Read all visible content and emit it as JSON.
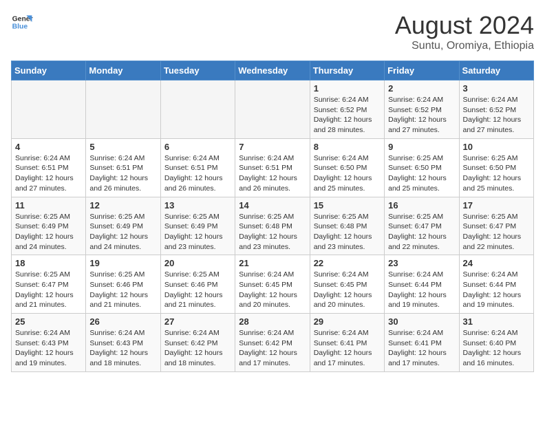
{
  "header": {
    "logo_line1": "General",
    "logo_line2": "Blue",
    "month_title": "August 2024",
    "location": "Suntu, Oromiya, Ethiopia"
  },
  "days_of_week": [
    "Sunday",
    "Monday",
    "Tuesday",
    "Wednesday",
    "Thursday",
    "Friday",
    "Saturday"
  ],
  "weeks": [
    [
      {
        "day": "",
        "info": ""
      },
      {
        "day": "",
        "info": ""
      },
      {
        "day": "",
        "info": ""
      },
      {
        "day": "",
        "info": ""
      },
      {
        "day": "1",
        "info": "Sunrise: 6:24 AM\nSunset: 6:52 PM\nDaylight: 12 hours\nand 28 minutes."
      },
      {
        "day": "2",
        "info": "Sunrise: 6:24 AM\nSunset: 6:52 PM\nDaylight: 12 hours\nand 27 minutes."
      },
      {
        "day": "3",
        "info": "Sunrise: 6:24 AM\nSunset: 6:52 PM\nDaylight: 12 hours\nand 27 minutes."
      }
    ],
    [
      {
        "day": "4",
        "info": "Sunrise: 6:24 AM\nSunset: 6:51 PM\nDaylight: 12 hours\nand 27 minutes."
      },
      {
        "day": "5",
        "info": "Sunrise: 6:24 AM\nSunset: 6:51 PM\nDaylight: 12 hours\nand 26 minutes."
      },
      {
        "day": "6",
        "info": "Sunrise: 6:24 AM\nSunset: 6:51 PM\nDaylight: 12 hours\nand 26 minutes."
      },
      {
        "day": "7",
        "info": "Sunrise: 6:24 AM\nSunset: 6:51 PM\nDaylight: 12 hours\nand 26 minutes."
      },
      {
        "day": "8",
        "info": "Sunrise: 6:24 AM\nSunset: 6:50 PM\nDaylight: 12 hours\nand 25 minutes."
      },
      {
        "day": "9",
        "info": "Sunrise: 6:25 AM\nSunset: 6:50 PM\nDaylight: 12 hours\nand 25 minutes."
      },
      {
        "day": "10",
        "info": "Sunrise: 6:25 AM\nSunset: 6:50 PM\nDaylight: 12 hours\nand 25 minutes."
      }
    ],
    [
      {
        "day": "11",
        "info": "Sunrise: 6:25 AM\nSunset: 6:49 PM\nDaylight: 12 hours\nand 24 minutes."
      },
      {
        "day": "12",
        "info": "Sunrise: 6:25 AM\nSunset: 6:49 PM\nDaylight: 12 hours\nand 24 minutes."
      },
      {
        "day": "13",
        "info": "Sunrise: 6:25 AM\nSunset: 6:49 PM\nDaylight: 12 hours\nand 23 minutes."
      },
      {
        "day": "14",
        "info": "Sunrise: 6:25 AM\nSunset: 6:48 PM\nDaylight: 12 hours\nand 23 minutes."
      },
      {
        "day": "15",
        "info": "Sunrise: 6:25 AM\nSunset: 6:48 PM\nDaylight: 12 hours\nand 23 minutes."
      },
      {
        "day": "16",
        "info": "Sunrise: 6:25 AM\nSunset: 6:47 PM\nDaylight: 12 hours\nand 22 minutes."
      },
      {
        "day": "17",
        "info": "Sunrise: 6:25 AM\nSunset: 6:47 PM\nDaylight: 12 hours\nand 22 minutes."
      }
    ],
    [
      {
        "day": "18",
        "info": "Sunrise: 6:25 AM\nSunset: 6:47 PM\nDaylight: 12 hours\nand 21 minutes."
      },
      {
        "day": "19",
        "info": "Sunrise: 6:25 AM\nSunset: 6:46 PM\nDaylight: 12 hours\nand 21 minutes."
      },
      {
        "day": "20",
        "info": "Sunrise: 6:25 AM\nSunset: 6:46 PM\nDaylight: 12 hours\nand 21 minutes."
      },
      {
        "day": "21",
        "info": "Sunrise: 6:24 AM\nSunset: 6:45 PM\nDaylight: 12 hours\nand 20 minutes."
      },
      {
        "day": "22",
        "info": "Sunrise: 6:24 AM\nSunset: 6:45 PM\nDaylight: 12 hours\nand 20 minutes."
      },
      {
        "day": "23",
        "info": "Sunrise: 6:24 AM\nSunset: 6:44 PM\nDaylight: 12 hours\nand 19 minutes."
      },
      {
        "day": "24",
        "info": "Sunrise: 6:24 AM\nSunset: 6:44 PM\nDaylight: 12 hours\nand 19 minutes."
      }
    ],
    [
      {
        "day": "25",
        "info": "Sunrise: 6:24 AM\nSunset: 6:43 PM\nDaylight: 12 hours\nand 19 minutes."
      },
      {
        "day": "26",
        "info": "Sunrise: 6:24 AM\nSunset: 6:43 PM\nDaylight: 12 hours\nand 18 minutes."
      },
      {
        "day": "27",
        "info": "Sunrise: 6:24 AM\nSunset: 6:42 PM\nDaylight: 12 hours\nand 18 minutes."
      },
      {
        "day": "28",
        "info": "Sunrise: 6:24 AM\nSunset: 6:42 PM\nDaylight: 12 hours\nand 17 minutes."
      },
      {
        "day": "29",
        "info": "Sunrise: 6:24 AM\nSunset: 6:41 PM\nDaylight: 12 hours\nand 17 minutes."
      },
      {
        "day": "30",
        "info": "Sunrise: 6:24 AM\nSunset: 6:41 PM\nDaylight: 12 hours\nand 17 minutes."
      },
      {
        "day": "31",
        "info": "Sunrise: 6:24 AM\nSunset: 6:40 PM\nDaylight: 12 hours\nand 16 minutes."
      }
    ]
  ]
}
